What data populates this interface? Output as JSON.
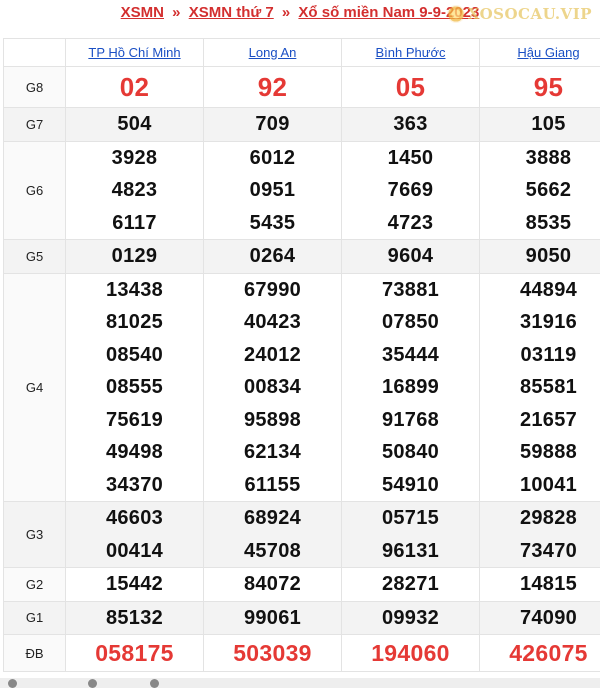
{
  "breadcrumb": {
    "item1": "XSMN",
    "separator": "»",
    "item2": "XSMN thứ 7",
    "item3": "Xổ số miền Nam 9-9-2023"
  },
  "logo_text": "XOSOCAU.VIP",
  "provinces": [
    "TP Hồ Chí Minh",
    "Long An",
    "Bình Phước",
    "Hậu Giang"
  ],
  "prizes": [
    {
      "label": "G8",
      "values": [
        [
          "02"
        ],
        [
          "92"
        ],
        [
          "05"
        ],
        [
          "95"
        ]
      ]
    },
    {
      "label": "G7",
      "values": [
        [
          "504"
        ],
        [
          "709"
        ],
        [
          "363"
        ],
        [
          "105"
        ]
      ]
    },
    {
      "label": "G6",
      "values": [
        [
          "3928",
          "4823",
          "6117"
        ],
        [
          "6012",
          "0951",
          "5435"
        ],
        [
          "1450",
          "7669",
          "4723"
        ],
        [
          "3888",
          "5662",
          "8535"
        ]
      ]
    },
    {
      "label": "G5",
      "values": [
        [
          "0129"
        ],
        [
          "0264"
        ],
        [
          "9604"
        ],
        [
          "9050"
        ]
      ]
    },
    {
      "label": "G4",
      "values": [
        [
          "13438",
          "81025",
          "08540",
          "08555",
          "75619",
          "49498",
          "34370"
        ],
        [
          "67990",
          "40423",
          "24012",
          "00834",
          "95898",
          "62134",
          "61155"
        ],
        [
          "73881",
          "07850",
          "35444",
          "16899",
          "91768",
          "50840",
          "54910"
        ],
        [
          "44894",
          "31916",
          "03119",
          "85581",
          "21657",
          "59888",
          "10041"
        ]
      ]
    },
    {
      "label": "G3",
      "values": [
        [
          "46603",
          "00414"
        ],
        [
          "68924",
          "45708"
        ],
        [
          "05715",
          "96131"
        ],
        [
          "29828",
          "73470"
        ]
      ]
    },
    {
      "label": "G2",
      "values": [
        [
          "15442"
        ],
        [
          "84072"
        ],
        [
          "28271"
        ],
        [
          "14815"
        ]
      ]
    },
    {
      "label": "G1",
      "values": [
        [
          "85132"
        ],
        [
          "99061"
        ],
        [
          "09932"
        ],
        [
          "74090"
        ]
      ]
    },
    {
      "label": "ĐB",
      "values": [
        [
          "058175"
        ],
        [
          "503039"
        ],
        [
          "194060"
        ],
        [
          "426075"
        ]
      ]
    }
  ],
  "colors": {
    "accent_red": "#e53935",
    "link_blue": "#1a4fc4",
    "alt_row": "#f3f3f3"
  }
}
